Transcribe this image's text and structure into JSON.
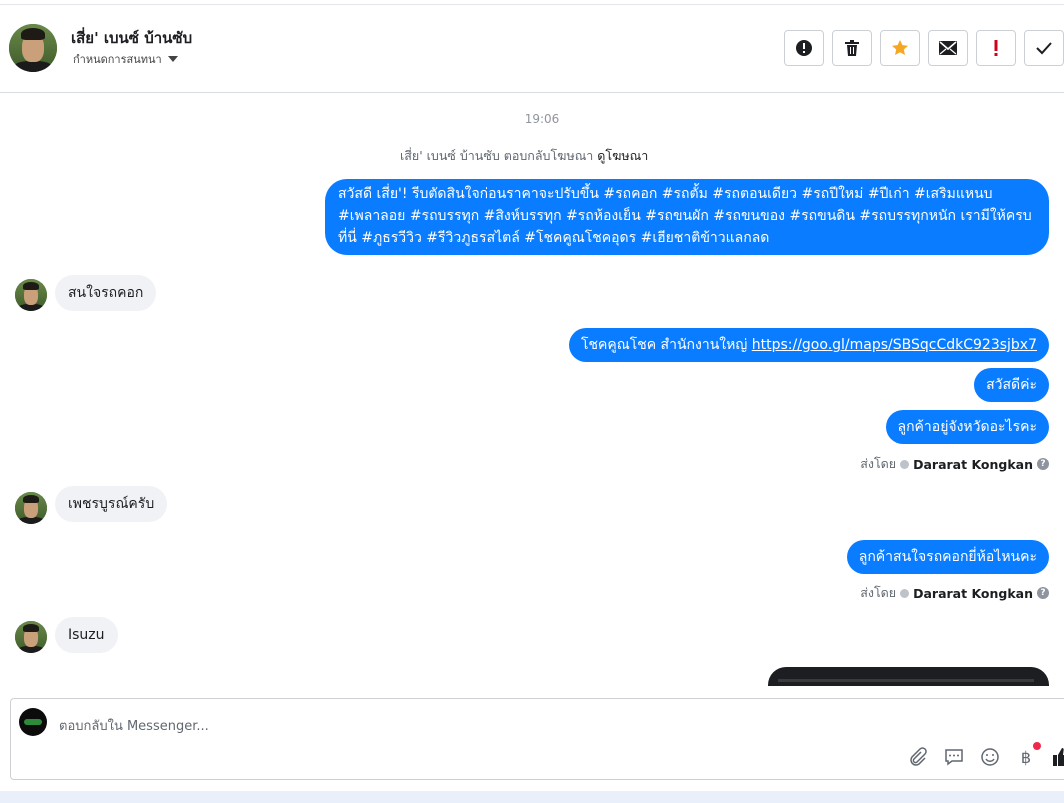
{
  "header": {
    "contact_name": "เสี่ย' เบนซ์ บ้านซับ",
    "assign_label": "กำหนดการสนทนา"
  },
  "actions": [
    {
      "name": "report-button",
      "icon": "alert-circle-icon"
    },
    {
      "name": "delete-button",
      "icon": "trash-icon"
    },
    {
      "name": "star-button",
      "icon": "star-icon",
      "color": "#f5a623"
    },
    {
      "name": "mark-unread-button",
      "icon": "envelope-icon"
    },
    {
      "name": "spam-button",
      "icon": "exclamation-icon",
      "color": "#d0021b"
    },
    {
      "name": "mark-done-button",
      "icon": "checkmark-icon"
    }
  ],
  "thread": {
    "timestamp": "19:06",
    "ad_reply_prefix": "เสี่ย' เบนซ์ บ้านซับ ตอบกลับโฆษณา",
    "ad_reply_link": "ดูโฆษณา",
    "messages": [
      {
        "dir": "out",
        "text": "สวัสดี เสี่ย'! รีบตัดสินใจก่อนราคาจะปรับขึ้น #รถคอก #รถตั้ม #รถตอนเดียว #รถปีใหม่ #ปีเก่า #เสริมแหนบ #เพลาลอย #รถบรรทุก #สิงห์บรรทุก #รถห้องเย็น #รถขนผัก #รถขนของ #รถขนดิน #รถบรรทุกหนัก เรามีให้ครบ ที่นี่ #ภูธรวีวิว #รีวิวภูธรสไตล์ #โชคคูณโชคอุดร #เฮียชาติข้าวแลกลด"
      },
      {
        "dir": "in",
        "text": "สนใจรถคอก"
      },
      {
        "dir": "out",
        "text_prefix": "โชคคูณโชค สำนักงานใหญ่ ",
        "link": "https://goo.gl/maps/SBSqcCdkC923sjbx7"
      },
      {
        "dir": "out",
        "text": "สวัสดีค่ะ"
      },
      {
        "dir": "out",
        "text": "ลูกค้าอยู่จังหวัดอะไรคะ"
      },
      {
        "dir": "in",
        "text": "เพชรบูรณ์ครับ"
      },
      {
        "dir": "out",
        "text": "ลูกค้าสนใจรถคอกยี่ห้อไหนคะ"
      },
      {
        "dir": "in",
        "text": "Isuzu"
      }
    ],
    "sent_by_label": "ส่งโดย",
    "agent_name": "Dararat Kongkan",
    "help_glyph": "?"
  },
  "composer": {
    "placeholder": "ตอบกลับใน Messenger...",
    "tools": [
      "paperclip-icon",
      "saved-replies-icon",
      "emoji-icon",
      "baht-payment-icon",
      "thumbs-up-icon"
    ],
    "baht_glyph": "฿"
  }
}
